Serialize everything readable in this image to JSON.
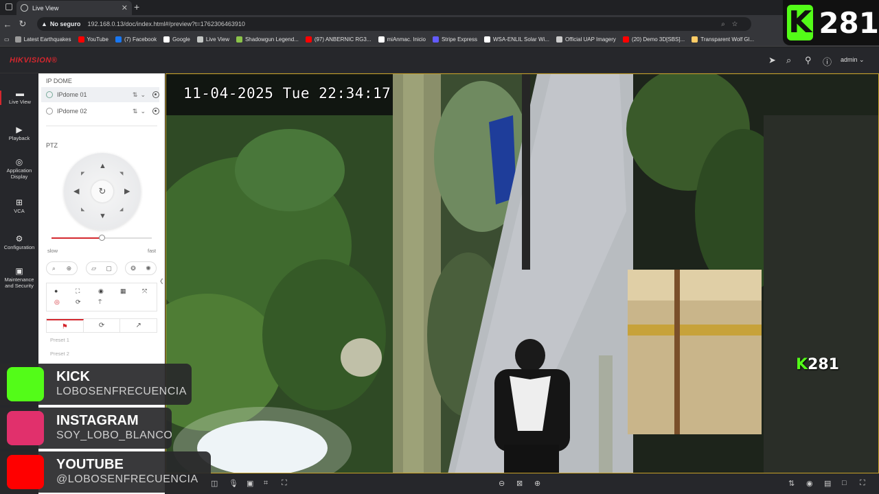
{
  "browser": {
    "tab_title": "Live View",
    "security_label": "No seguro",
    "url": "192.168.0.13/doc/index.html#/preview?t=1762306463910",
    "bookmarks": [
      {
        "label": "Latest Earthquakes",
        "color": "#9b9b9b"
      },
      {
        "label": "YouTube",
        "color": "#ff0000"
      },
      {
        "label": "(7) Facebook",
        "color": "#1877f2"
      },
      {
        "label": "Google",
        "color": "#ffffff"
      },
      {
        "label": "Live View",
        "color": "#c4c7c5"
      },
      {
        "label": "Shadowgun Legend...",
        "color": "#8bc34a"
      },
      {
        "label": "(97) ANBERNIC RG3...",
        "color": "#ff0000"
      },
      {
        "label": "miAnmac. Inicio",
        "color": "#ffffff"
      },
      {
        "label": "Stripe Express",
        "color": "#635bff"
      },
      {
        "label": "WSA-ENLIL Solar Wi...",
        "color": "#ffffff"
      },
      {
        "label": "Official UAP Imagery",
        "color": "#cccccc"
      },
      {
        "label": "(20) Demo 3D[SBS]...",
        "color": "#ff0000"
      },
      {
        "label": "Transparent Wolf Gl...",
        "color": "#ffcc66"
      }
    ]
  },
  "app": {
    "logo": "HIKVISION®",
    "user": "admin",
    "nav": [
      {
        "label": "Live View",
        "icon": "monitor-icon",
        "glyph": "▬"
      },
      {
        "label": "Playback",
        "icon": "playback-icon",
        "glyph": "▶"
      },
      {
        "label": "Application Display",
        "icon": "app-display-icon",
        "glyph": "◎"
      },
      {
        "label": "VCA",
        "icon": "vca-icon",
        "glyph": "⊞"
      },
      {
        "label": "Configuration",
        "icon": "gear-icon",
        "glyph": "⚙"
      },
      {
        "label": "Maintenance and Security",
        "icon": "maintenance-icon",
        "glyph": "▣"
      }
    ]
  },
  "panel": {
    "group_title": "IP DOME",
    "cameras": [
      "IPdome 01",
      "IPdome 02"
    ],
    "ptz_title": "PTZ",
    "speed": {
      "slow": "slow",
      "fast": "fast",
      "value": 0.5
    },
    "presets": [
      "Preset 1",
      "Preset 2"
    ]
  },
  "video": {
    "osd_timestamp": "11-04-2025 Tue 22:34:17",
    "watermark_num": "281"
  },
  "overlays": {
    "kick_badge_num": "281",
    "socials": [
      {
        "title": "KICK",
        "handle": "LOBOSENFRECUENCIA",
        "color": "#53fc18"
      },
      {
        "title": "INSTAGRAM",
        "handle": "SOY_LOBO_BLANCO",
        "color": "#e1306c"
      },
      {
        "title": "YOUTUBE",
        "handle": "@LOBOSENFRECUENCIA",
        "color": "#ff0000"
      }
    ]
  }
}
